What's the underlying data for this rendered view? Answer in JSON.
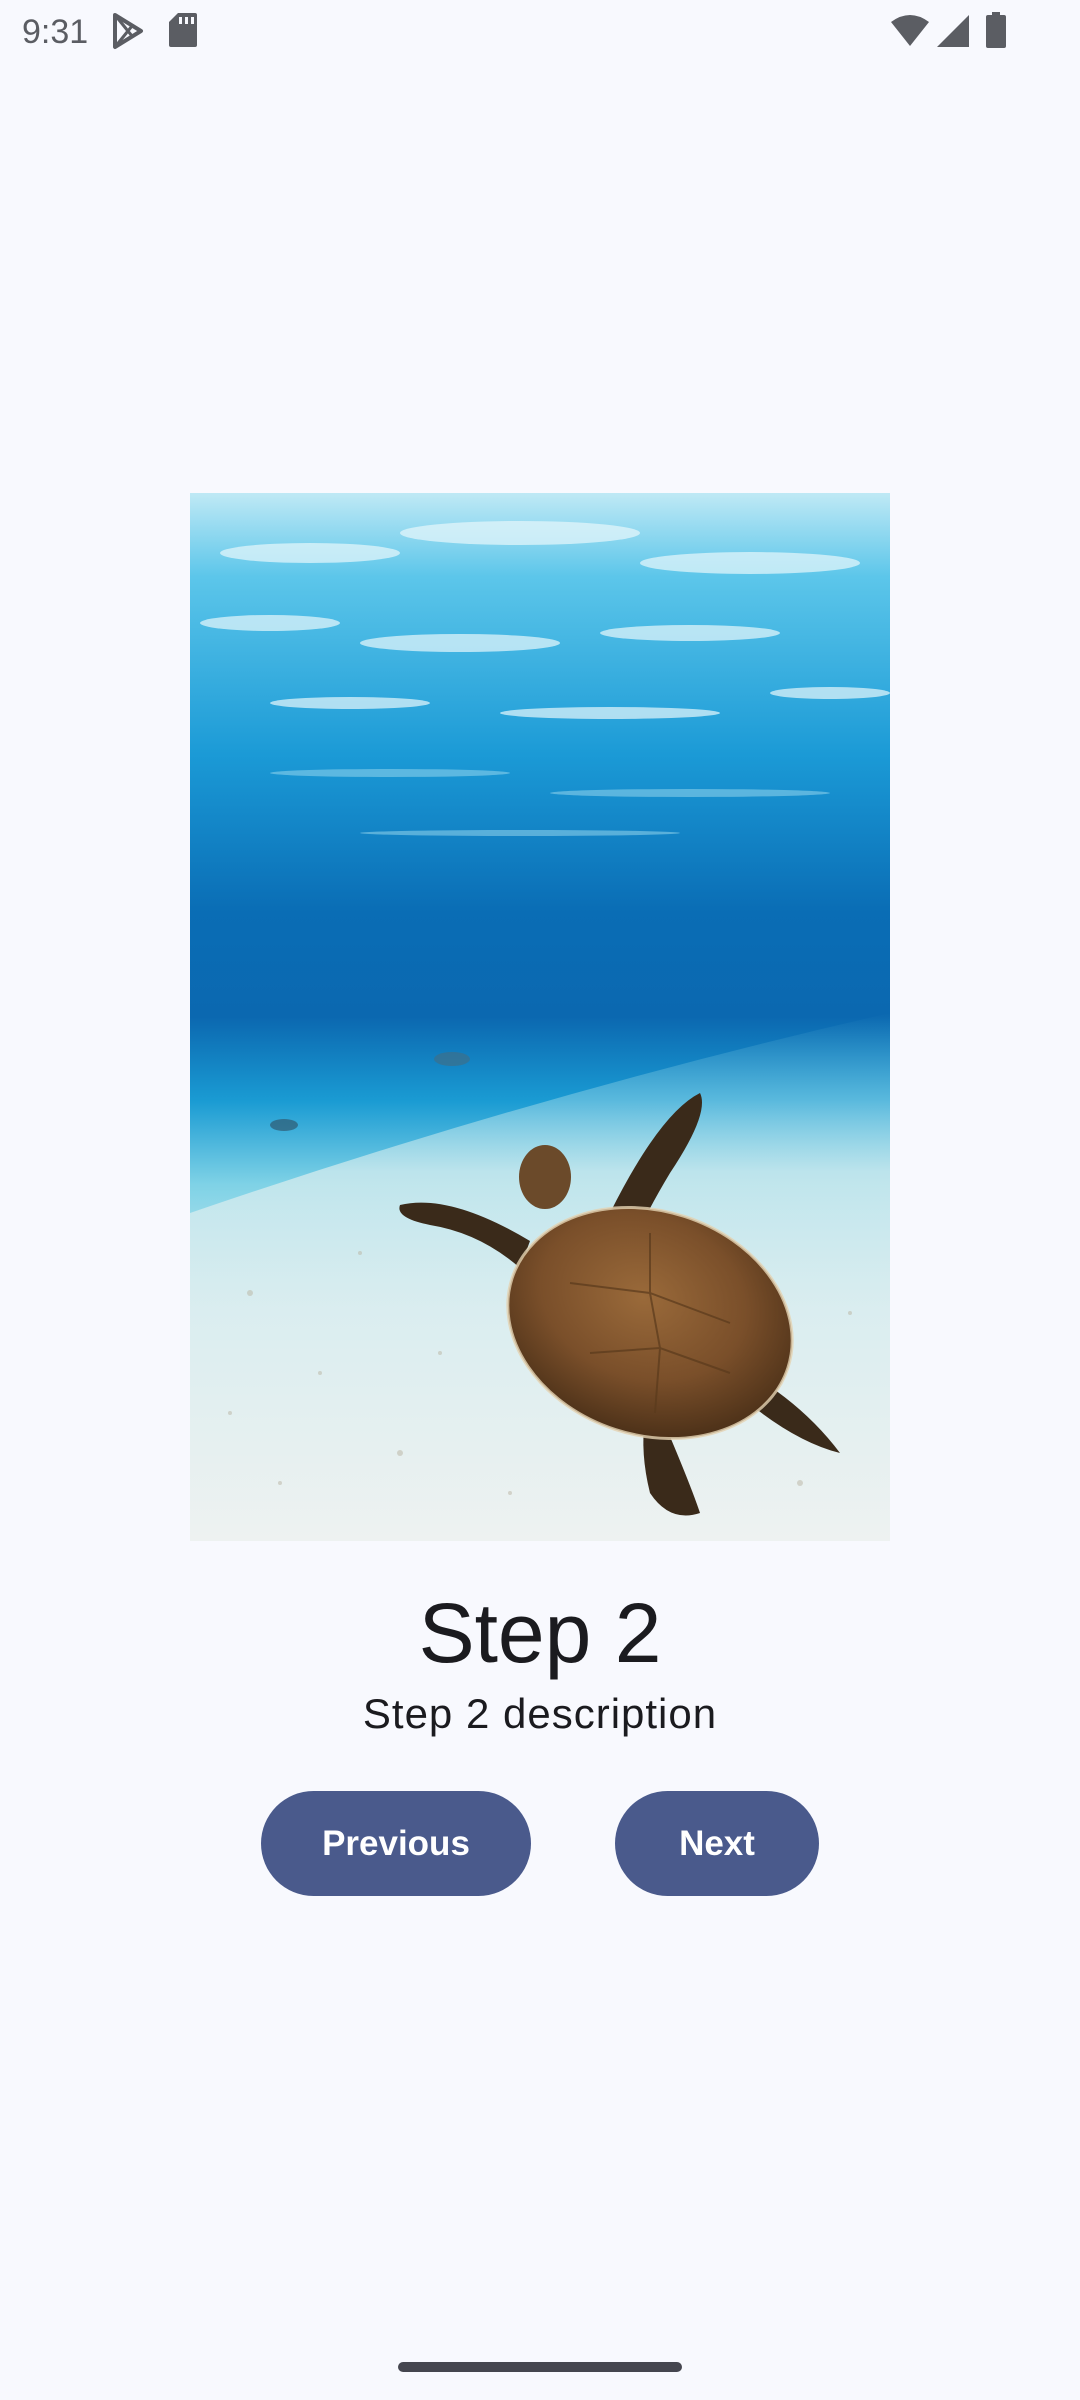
{
  "status_bar": {
    "time": "9:31",
    "icons": [
      "play-store-icon",
      "sd-card-icon",
      "wifi-icon",
      "cell-signal-icon",
      "battery-icon"
    ]
  },
  "hero_image": {
    "subject": "sea-turtle-underwater"
  },
  "step": {
    "title": "Step 2",
    "description": "Step 2 description"
  },
  "buttons": {
    "previous_label": "Previous",
    "next_label": "Next"
  },
  "colors": {
    "background": "#f8f9fe",
    "button": "#4a5a8c",
    "button_text": "#ffffff",
    "text": "#1b1b1f"
  }
}
